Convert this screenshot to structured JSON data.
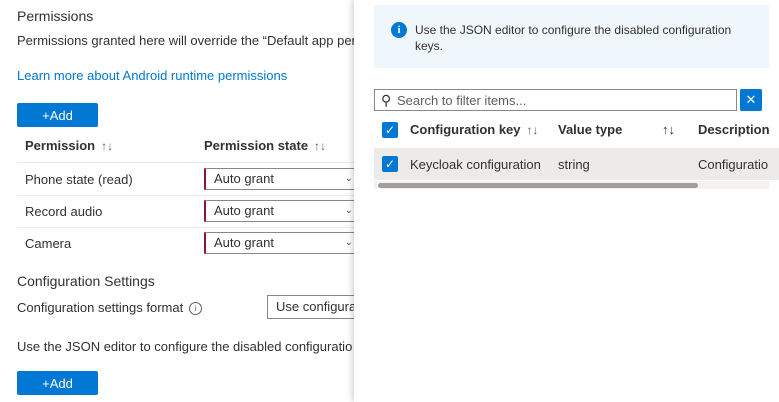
{
  "permissions": {
    "title": "Permissions",
    "description": "Permissions granted here will override the “Default app per",
    "learn_more": "Learn more about Android runtime permissions",
    "add_label": "+Add",
    "col_permission": "Permission",
    "col_state": "Permission state",
    "sort_glyph": "↑↓",
    "rows": [
      {
        "name": "Phone state (read)",
        "state": "Auto grant"
      },
      {
        "name": "Record audio",
        "state": "Auto grant"
      },
      {
        "name": "Camera",
        "state": "Auto grant"
      }
    ]
  },
  "config": {
    "title": "Configuration Settings",
    "format_label": "Configuration settings format",
    "format_value": "Use configura",
    "json_note": "Use the JSON editor to configure the disabled configuratio",
    "add_label": "+Add"
  },
  "panel": {
    "info_message": "Use the JSON editor to configure the disabled configuration keys.",
    "filter_placeholder": "Search to filter items...",
    "columns": {
      "key": "Configuration key",
      "type": "Value type",
      "description": "Description"
    },
    "rows": [
      {
        "key": "Keycloak configuration",
        "type": "string",
        "description": "Configuratio"
      }
    ]
  },
  "colors": {
    "accent": "#0078d4",
    "info_bg": "#eff6fc",
    "selected_row": "#edebe9"
  }
}
